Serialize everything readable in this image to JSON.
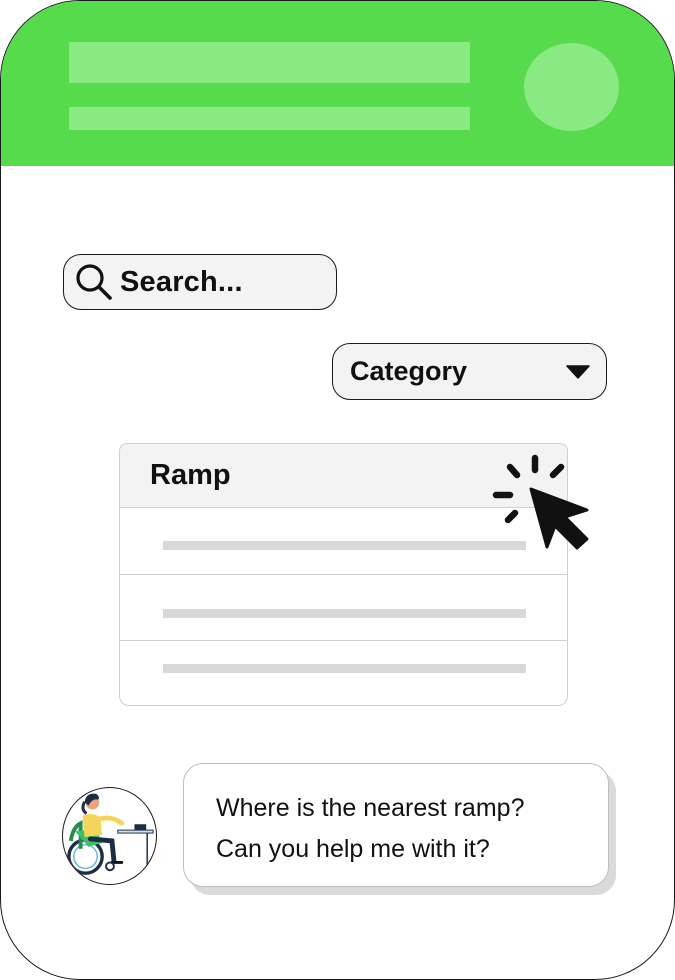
{
  "header": {
    "color": "#56db4d",
    "placeholder_color": "#8ae982"
  },
  "search": {
    "label": "Search...",
    "icon": "search-icon"
  },
  "category": {
    "label": "Category",
    "icon": "caret-down-icon"
  },
  "list": {
    "header": "Ramp",
    "rows": 3
  },
  "cursor": {
    "icon": "click-cursor-icon"
  },
  "chat": {
    "avatar": "wheelchair-user-avatar",
    "message_line_1": "Where is the nearest ramp?",
    "message_line_2": "Can you help me with it?"
  }
}
